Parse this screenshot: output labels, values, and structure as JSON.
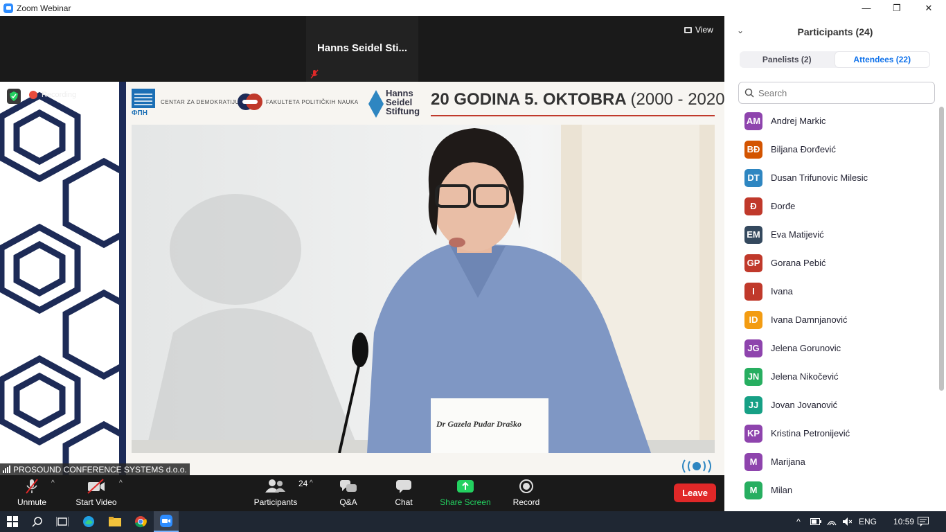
{
  "window": {
    "title": "Zoom Webinar",
    "controls": {
      "minimize": "—",
      "restore": "❐",
      "close": "✕"
    }
  },
  "stage": {
    "panelist_name": "Hanns Seidel Sti...",
    "view_label": "View",
    "recording_label": "Recording",
    "presenter_label": "PROSOUND CONFERENCE SYSTEMS d.o.o."
  },
  "banner": {
    "org1": "ФПН",
    "org2": "CENTAR ZA DEMOKRATIJU",
    "org3": "FAKULTETA POLITIČKIH NAUKA",
    "org4": "Hanns Seidel Stiftung",
    "headline_main": "20 GODINA 5. OKTOBRA ",
    "headline_years": "(2000 - 2020)",
    "nameplate": "Dr Gazela Pudar Draško"
  },
  "toolbar": {
    "unmute": "Unmute",
    "start_video": "Start Video",
    "participants": "Participants",
    "participants_count": "24",
    "qa": "Q&A",
    "chat": "Chat",
    "share_screen": "Share Screen",
    "record": "Record",
    "leave": "Leave"
  },
  "panel": {
    "title": "Participants (24)",
    "tabs": [
      {
        "label": "Panelists (2)",
        "active": false
      },
      {
        "label": "Attendees (22)",
        "active": true
      }
    ],
    "search_placeholder": "Search",
    "attendees": [
      {
        "initials": "AM",
        "name": "Andrej Markic",
        "color": "#8e44ad"
      },
      {
        "initials": "BĐ",
        "name": "Biljana Đorđević",
        "color": "#d35400"
      },
      {
        "initials": "DT",
        "name": "Dusan Trifunovic Milesic",
        "color": "#2e86c1"
      },
      {
        "initials": "Đ",
        "name": "Đorđe",
        "color": "#c0392b"
      },
      {
        "initials": "EM",
        "name": "Eva Matijević",
        "color": "#34495e"
      },
      {
        "initials": "GP",
        "name": "Gorana Pebić",
        "color": "#c0392b"
      },
      {
        "initials": "I",
        "name": "Ivana",
        "color": "#c0392b"
      },
      {
        "initials": "ID",
        "name": "Ivana Damnjanović",
        "color": "#f39c12"
      },
      {
        "initials": "JG",
        "name": "Jelena Gorunovic",
        "color": "#8e44ad"
      },
      {
        "initials": "JN",
        "name": "Jelena Nikočević",
        "color": "#27ae60"
      },
      {
        "initials": "JJ",
        "name": "Jovan Jovanović",
        "color": "#16a085"
      },
      {
        "initials": "KP",
        "name": "Kristina Petronijević",
        "color": "#8e44ad"
      },
      {
        "initials": "M",
        "name": "Marijana",
        "color": "#8e44ad"
      },
      {
        "initials": "M",
        "name": "Milan",
        "color": "#27ae60"
      }
    ]
  },
  "taskbar": {
    "language": "ENG",
    "time": "10:59"
  }
}
